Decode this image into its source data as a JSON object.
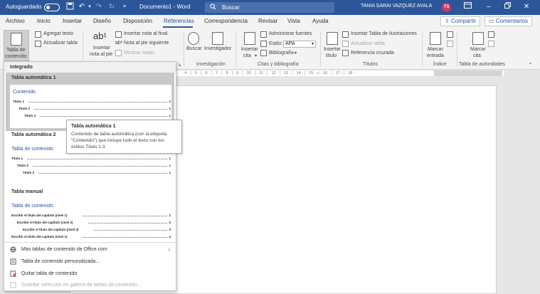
{
  "titlebar": {
    "autosave_label": "Autoguardado",
    "toggle_state": "off",
    "doc_title": "Documento1  -  Word",
    "search_placeholder": "Buscar",
    "user_name": "TANIA SARAI VAZQUEZ AYALA",
    "user_initials": "TS",
    "colors": {
      "bar": "#2b579a",
      "avatar": "#c43a6a"
    }
  },
  "tabs": {
    "items": [
      "Archivo",
      "Inicio",
      "Insertar",
      "Diseño",
      "Disposición",
      "Referencias",
      "Correspondencia",
      "Revisar",
      "Vista",
      "Ayuda"
    ],
    "active": "Referencias",
    "share": "Compartir",
    "comments": "Comentarios"
  },
  "ribbon": {
    "toc": {
      "table_line1": "Tabla de",
      "table_line2": "contenido",
      "add_text": "Agregar texto",
      "update_table": "Actualizar tabla"
    },
    "footnotes": {
      "insert_line1": "Insertar",
      "insert_line2": "nota al pie",
      "insert_endnote": "Insertar nota al final",
      "next_footnote": "Nota al pie siguiente",
      "show_notes": "Mostrar notas"
    },
    "research": {
      "search": "Buscar",
      "researcher": "Investigador",
      "group": "Investigación"
    },
    "citations": {
      "insert_line1": "Insertar",
      "insert_line2": "cita",
      "manage_sources": "Administrar fuentes",
      "style_label": "Estilo:",
      "style_value": "APA",
      "bibliography": "Bibliografía",
      "group": "Citas y bibliografía"
    },
    "captions": {
      "insert_line1": "Insertar",
      "insert_line2": "título",
      "insert_table_of_figures": "Insertar Tabla de ilustraciones",
      "update_table": "Actualizar tabla",
      "cross_reference": "Referencia cruzada",
      "group": "Títulos"
    },
    "index": {
      "mark_line1": "Marcar",
      "mark_line2": "entrada",
      "group": "Índice"
    },
    "authorities": {
      "mark_line1": "Marcar",
      "mark_line2": "cita",
      "group": "Tabla de autoridades"
    }
  },
  "ruler": {
    "text": "· 4 · ¦ · 5 · ¦ · 6 · ¦ · 7 · ¦ · 8 · ¦ · 9 · ¦ · 10 · ¦ · 11 · ¦ · 12 · ¦ · 13 · ¦ · 14 · ¦ · 15 · ◇ · 16 · ¦ · 17 · ¦ · 18 ·"
  },
  "menu": {
    "header": "Integrado",
    "gallery": [
      {
        "title": "Tabla automática 1",
        "heading": "Contenido",
        "lines": [
          {
            "text": "Título 1",
            "num": "1"
          },
          {
            "text": "Título 2",
            "num": "1"
          },
          {
            "text": "Título 3",
            "num": "1"
          }
        ]
      },
      {
        "title": "Tabla automática 2",
        "heading": "Tabla de contenido",
        "lines": [
          {
            "text": "Título 1",
            "num": "1"
          },
          {
            "text": "Título 2",
            "num": "1"
          },
          {
            "text": "Título 3",
            "num": "1"
          }
        ]
      },
      {
        "title": "Tabla manual",
        "heading": "Tabla de contenido",
        "lines": [
          {
            "text": "Escribir el título del capítulo (nivel 1)",
            "num": "1"
          },
          {
            "text": "Escribir el título del capítulo (nivel 2)",
            "num": "2"
          },
          {
            "text": "Escribir el título del capítulo (nivel 3)",
            "num": "3"
          },
          {
            "text": "Escribir el título del capítulo (nivel 1)",
            "num": "4"
          }
        ]
      }
    ],
    "actions": [
      "Más tablas de contenido de Office.com",
      "Tabla de contenido personalizada...",
      "Quitar tabla de contenido",
      "Guardar selección en galería de tablas de contenido..."
    ]
  },
  "tooltip": {
    "title": "Tabla automática 1",
    "body": "Contenido de tabla automática (con la etiqueta \"Contenido\") que incluye todo el texto con los estilos Título 1-3"
  }
}
